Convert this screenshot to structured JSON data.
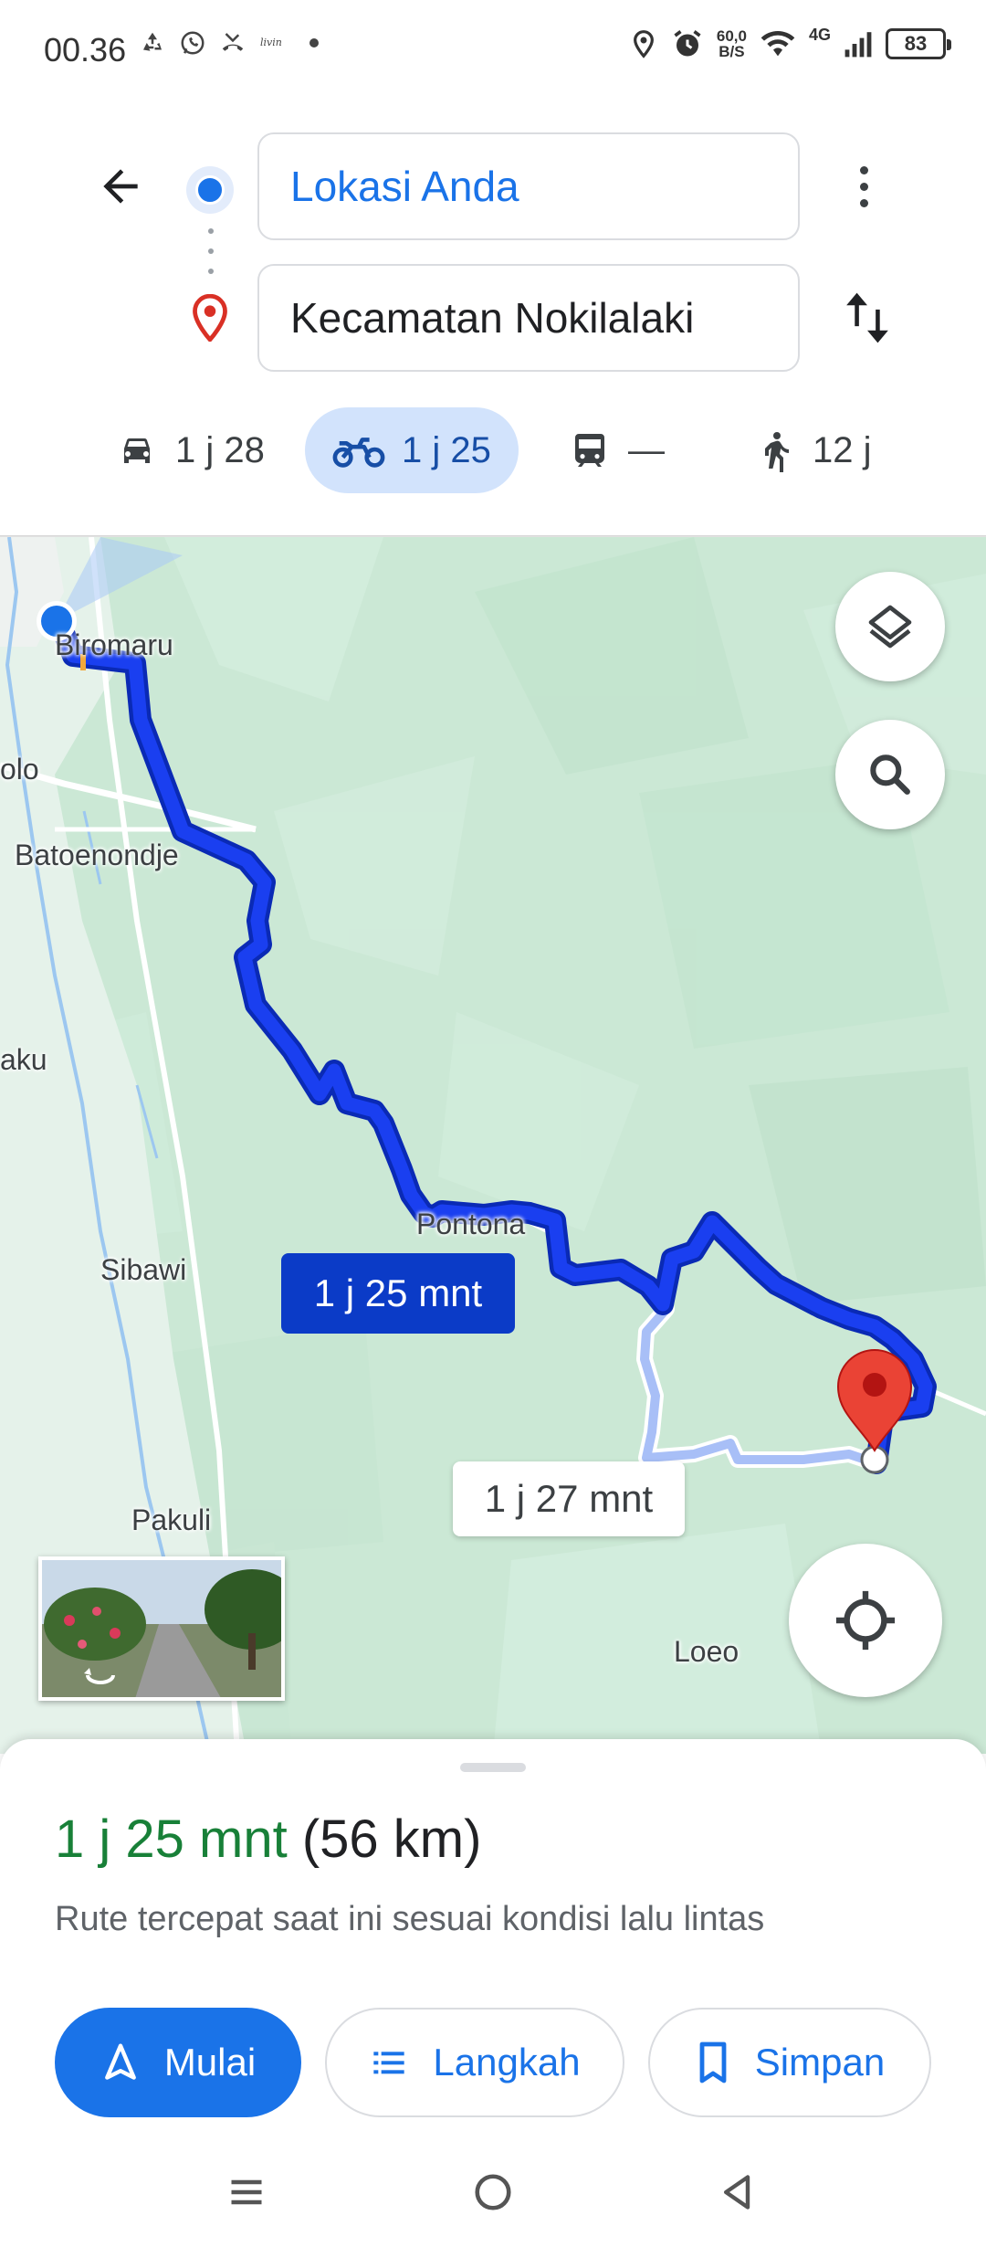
{
  "status_bar": {
    "time": "00.36",
    "speed_value": "60,0",
    "speed_unit": "B/S",
    "network": "4G",
    "battery": "83"
  },
  "directions": {
    "origin": "Lokasi Anda",
    "destination": "Kecamatan Nokilalaki"
  },
  "modes": [
    {
      "name": "car",
      "value": "1 j 28"
    },
    {
      "name": "motorcycle",
      "value": "1 j 25",
      "active": true
    },
    {
      "name": "transit",
      "value": "—"
    },
    {
      "name": "walk",
      "value": "12 j"
    }
  ],
  "map": {
    "places": [
      "Biromaru",
      "olo",
      "Batoenondje",
      "aku",
      "Pontona",
      "Sibawi",
      "Pakuli",
      "Loeo"
    ],
    "route_primary_time": "1 j 25 mnt",
    "route_alt_time": "1 j 27 mnt",
    "route_color": "#1a3ff0",
    "alt_route_color": "#a8bff7"
  },
  "sheet": {
    "duration": "1 j 25 mnt",
    "distance": "(56 km)",
    "description": "Rute tercepat saat ini sesuai kondisi lalu lintas",
    "start_label": "Mulai",
    "steps_label": "Langkah",
    "save_label": "Simpan"
  },
  "colors": {
    "accent": "#1a73e8",
    "duration_green": "#188038",
    "active_mode_bg": "#d2e3fc"
  }
}
